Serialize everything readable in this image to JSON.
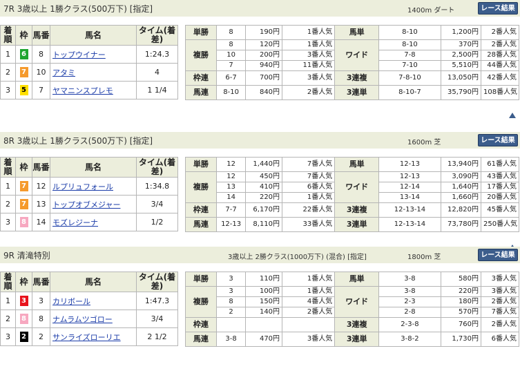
{
  "colors": {
    "header_bg": "#eceedc",
    "link": "#1a3ba8",
    "button": "#3c5d8c"
  },
  "labels": {
    "result_headers": {
      "finish": "着順",
      "waku": "枠",
      "umaban": "馬番",
      "horse": "馬名",
      "time": "タイム(着差)"
    },
    "win": "単勝",
    "place": "複勝",
    "bracket": "枠連",
    "quinella": "馬連",
    "exacta": "馬単",
    "wide": "ワイド",
    "trio": "3連複",
    "trifecta": "3連単",
    "race_button": "レース結果",
    "up_icon": "up-triangle-icon"
  },
  "races": [
    {
      "title": "7R 3歳以上 1勝クラス(500万下) [指定]",
      "condition": "",
      "distance": "1400m  ダート",
      "results": [
        {
          "finish": "1",
          "waku": "6",
          "umaban": "8",
          "horse": "トップウイナー",
          "time": "1:24.3"
        },
        {
          "finish": "2",
          "waku": "7",
          "umaban": "10",
          "horse": "アタミ",
          "time": "4"
        },
        {
          "finish": "3",
          "waku": "5",
          "umaban": "7",
          "horse": "ヤマニンスプレモ",
          "time": "1 1/4"
        }
      ],
      "win": {
        "nums": [
          "8"
        ],
        "pays": [
          "190円"
        ],
        "pops": [
          "1番人気"
        ]
      },
      "place": {
        "nums": [
          "8",
          "10",
          "7"
        ],
        "pays": [
          "120円",
          "200円",
          "940円"
        ],
        "pops": [
          "1番人気",
          "3番人気",
          "11番人気"
        ]
      },
      "bracket": {
        "nums": "6-7",
        "pay": "700円",
        "pop": "3番人気"
      },
      "quinella": {
        "nums": "8-10",
        "pay": "840円",
        "pop": "2番人気"
      },
      "exacta": {
        "nums": "8-10",
        "pay": "1,200円",
        "pop": "2番人気"
      },
      "wide": {
        "nums": [
          "8-10",
          "7-8",
          "7-10"
        ],
        "pays": [
          "370円",
          "2,500円",
          "5,510円"
        ],
        "pops": [
          "2番人気",
          "28番人気",
          "44番人気"
        ]
      },
      "trio": {
        "nums": "7-8-10",
        "pay": "13,050円",
        "pop": "42番人気"
      },
      "trifecta": {
        "nums": "8-10-7",
        "pay": "35,790円",
        "pop": "108番人気"
      }
    },
    {
      "title": "8R 3歳以上 1勝クラス(500万下) [指定]",
      "condition": "",
      "distance": "1600m  芝",
      "results": [
        {
          "finish": "1",
          "waku": "7",
          "umaban": "12",
          "horse": "ルプリュフォール",
          "time": "1:34.8"
        },
        {
          "finish": "2",
          "waku": "7",
          "umaban": "13",
          "horse": "トップオブメジャー",
          "time": "3/4"
        },
        {
          "finish": "3",
          "waku": "8",
          "umaban": "14",
          "horse": "モズレジーナ",
          "time": "1/2"
        }
      ],
      "win": {
        "nums": [
          "12"
        ],
        "pays": [
          "1,440円"
        ],
        "pops": [
          "7番人気"
        ]
      },
      "place": {
        "nums": [
          "12",
          "13",
          "14"
        ],
        "pays": [
          "450円",
          "410円",
          "220円"
        ],
        "pops": [
          "7番人気",
          "6番人気",
          "1番人気"
        ]
      },
      "bracket": {
        "nums": "7-7",
        "pay": "6,170円",
        "pop": "22番人気"
      },
      "quinella": {
        "nums": "12-13",
        "pay": "8,110円",
        "pop": "33番人気"
      },
      "exacta": {
        "nums": "12-13",
        "pay": "13,940円",
        "pop": "61番人気"
      },
      "wide": {
        "nums": [
          "12-13",
          "12-14",
          "13-14"
        ],
        "pays": [
          "3,090円",
          "1,640円",
          "1,660円"
        ],
        "pops": [
          "43番人気",
          "17番人気",
          "20番人気"
        ]
      },
      "trio": {
        "nums": "12-13-14",
        "pay": "12,820円",
        "pop": "45番人気"
      },
      "trifecta": {
        "nums": "12-13-14",
        "pay": "73,780円",
        "pop": "250番人気"
      }
    },
    {
      "title": "9R 清滝特別",
      "condition": "3歳以上 2勝クラス(1000万下) (混合) [指定]",
      "distance": "1800m  芝",
      "results": [
        {
          "finish": "1",
          "waku": "3",
          "umaban": "3",
          "horse": "カリボール",
          "time": "1:47.3"
        },
        {
          "finish": "2",
          "waku": "8",
          "umaban": "8",
          "horse": "ナムラムツゴロー",
          "time": "3/4"
        },
        {
          "finish": "3",
          "waku": "2",
          "umaban": "2",
          "horse": "サンライズローリエ",
          "time": "2 1/2"
        }
      ],
      "win": {
        "nums": [
          "3"
        ],
        "pays": [
          "110円"
        ],
        "pops": [
          "1番人気"
        ]
      },
      "place": {
        "nums": [
          "3",
          "8",
          "2"
        ],
        "pays": [
          "100円",
          "150円",
          "140円"
        ],
        "pops": [
          "1番人気",
          "4番人気",
          "2番人気"
        ]
      },
      "bracket": {
        "nums": "",
        "pay": "",
        "pop": ""
      },
      "quinella": {
        "nums": "3-8",
        "pay": "470円",
        "pop": "3番人気"
      },
      "exacta": {
        "nums": "3-8",
        "pay": "580円",
        "pop": "3番人気"
      },
      "wide": {
        "nums": [
          "3-8",
          "2-3",
          "2-8"
        ],
        "pays": [
          "220円",
          "180円",
          "570円"
        ],
        "pops": [
          "3番人気",
          "2番人気",
          "7番人気"
        ]
      },
      "trio": {
        "nums": "2-3-8",
        "pay": "760円",
        "pop": "2番人気"
      },
      "trifecta": {
        "nums": "3-8-2",
        "pay": "1,730円",
        "pop": "6番人気"
      }
    }
  ]
}
